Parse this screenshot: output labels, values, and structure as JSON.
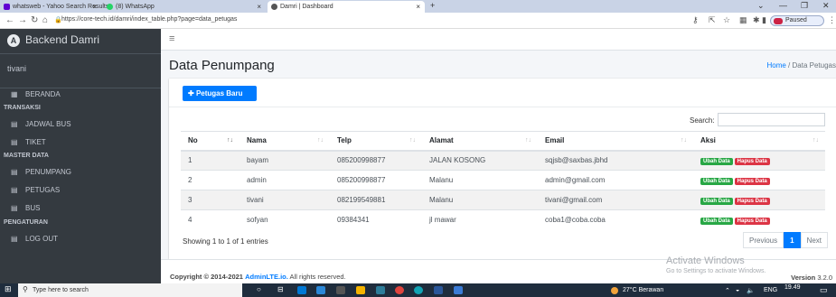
{
  "browser": {
    "tabs": [
      {
        "label": "whatsweb - Yahoo Search Results",
        "color": "#6001d2"
      },
      {
        "label": "(8) WhatsApp",
        "color": "#25d366"
      },
      {
        "label": "Damri | Dashboard",
        "color": "#555555"
      }
    ],
    "new_tab": "+",
    "url": "https://core-tech.id/damri/index_table.php?page=data_petugas",
    "profile_status": "Paused"
  },
  "sidebar": {
    "brand": "Backend Damri",
    "user": "tivani",
    "items": [
      {
        "label": "BERANDA",
        "icon": "table-icon"
      },
      {
        "header": "TRANSAKSI"
      },
      {
        "label": "JADWAL BUS",
        "icon": "calendar-icon"
      },
      {
        "label": "TIKET",
        "icon": "calendar-icon"
      },
      {
        "header": "MASTER DATA"
      },
      {
        "label": "PENUMPANG",
        "icon": "calendar-icon"
      },
      {
        "label": "PETUGAS",
        "icon": "calendar-icon"
      },
      {
        "label": "BUS",
        "icon": "calendar-icon"
      },
      {
        "header": "PENGATURAN"
      },
      {
        "label": "LOG OUT",
        "icon": "calendar-icon"
      }
    ]
  },
  "page": {
    "title": "Data Penumpang",
    "breadcrumb": {
      "home": "Home",
      "sep": "/",
      "current": "Data Petugas"
    },
    "add_button": "Petugas Baru",
    "search_label": "Search:",
    "search_value": ""
  },
  "table": {
    "columns": [
      "No",
      "Nama",
      "Telp",
      "Alamat",
      "Email",
      "Aksi"
    ],
    "rows": [
      {
        "no": "1",
        "nama": "bayam",
        "telp": "085200998877",
        "alamat": "JALAN KOSONG",
        "email": "sqjsb@saxbas.jbhd"
      },
      {
        "no": "2",
        "nama": "admin",
        "telp": "085200998877",
        "alamat": "Malanu",
        "email": "admin@gmail.com"
      },
      {
        "no": "3",
        "nama": "tivani",
        "telp": "082199549881",
        "alamat": "Malanu",
        "email": "tivani@gmail.com"
      },
      {
        "no": "4",
        "nama": "sofyan",
        "telp": "09384341",
        "alamat": "jl mawar",
        "email": "coba1@coba.coba"
      }
    ],
    "edit_label": "Ubah Data",
    "delete_label": "Hapus Data",
    "info": "Showing 1 to 1 of 1 entries",
    "pagination": {
      "previous": "Previous",
      "current": "1",
      "next": "Next"
    }
  },
  "footer": {
    "copyright_prefix": "Copyright © 2014-2021",
    "copyright_link": "AdminLTE.io.",
    "copyright_suffix": "All rights reserved.",
    "version_label": "Version",
    "version_number": "3.2.0"
  },
  "watermark": {
    "line1": "Activate Windows",
    "line2": "Go to Settings to activate Windows."
  },
  "taskbar": {
    "search_placeholder": "Type here to search",
    "weather": "27°C Berawan",
    "lang": "ENG",
    "time": "19.49"
  },
  "colors": {
    "primary": "#007bff",
    "success": "#28a745",
    "danger": "#dc3545",
    "sidebar": "#343a40"
  }
}
